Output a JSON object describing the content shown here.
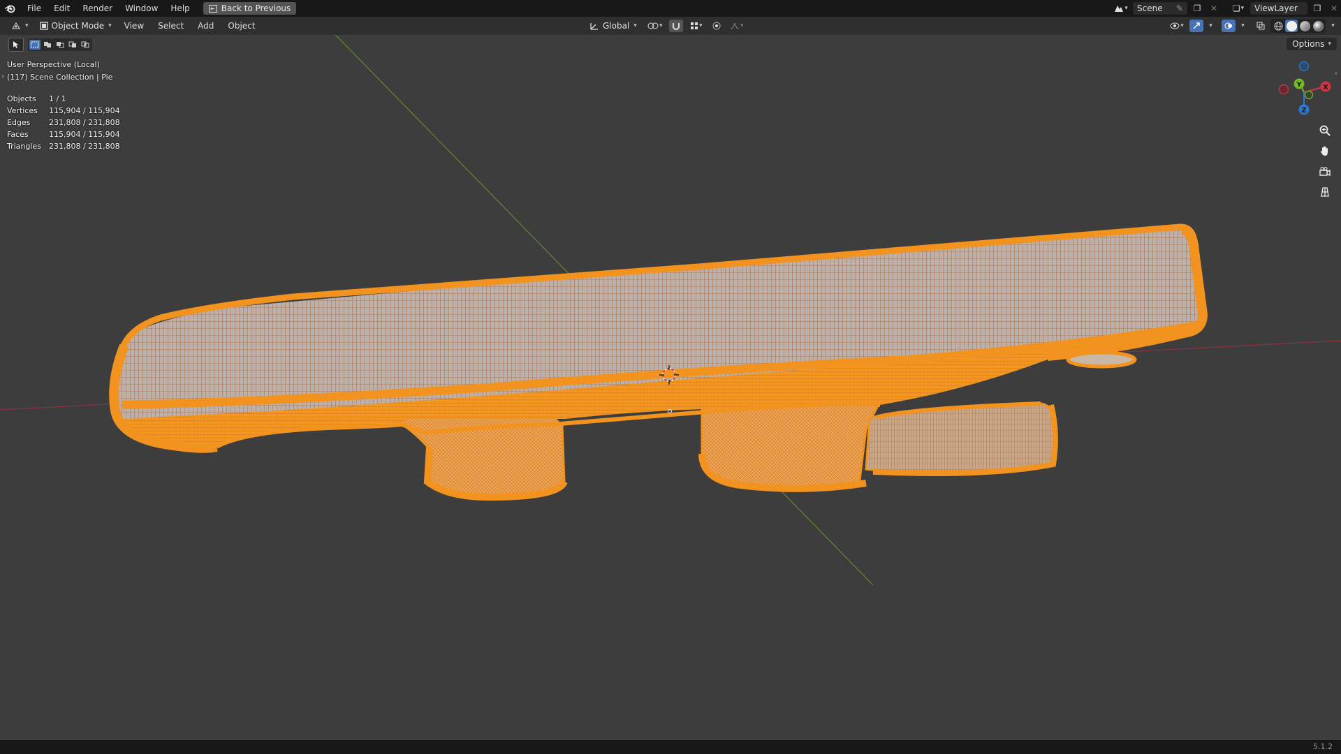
{
  "topbar": {
    "menus": [
      "File",
      "Edit",
      "Render",
      "Window",
      "Help"
    ],
    "back_button": "Back to Previous",
    "scene_name": "Scene",
    "view_layer": "ViewLayer"
  },
  "header": {
    "mode": "Object Mode",
    "menus": [
      "View",
      "Select",
      "Add",
      "Object"
    ],
    "transform_orientation": "Global",
    "options": "Options"
  },
  "viewport": {
    "perspective": "User Perspective (Local)",
    "collection": "(117) Scene Collection | Pie",
    "stats": [
      {
        "label": "Objects",
        "value": "1 / 1"
      },
      {
        "label": "Vertices",
        "value": "115,904 / 115,904"
      },
      {
        "label": "Edges",
        "value": "231,808 / 231,808"
      },
      {
        "label": "Faces",
        "value": "115,904 / 115,904"
      },
      {
        "label": "Triangles",
        "value": "231,808 / 231,808"
      }
    ],
    "gizmo": {
      "x": "X",
      "y": "Y",
      "z": "Z"
    },
    "colors": {
      "selection": "#f2921f",
      "x_axis": "#d0364a",
      "y_axis": "#76b82a",
      "z_axis": "#2a7ad5"
    }
  },
  "statusbar": {
    "version": "5.1.2"
  }
}
